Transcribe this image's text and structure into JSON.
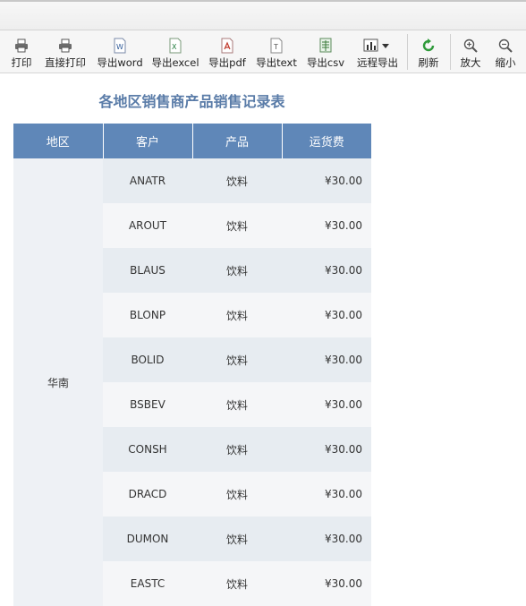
{
  "toolbar": {
    "items": [
      {
        "label": "打印",
        "icon": "printer-icon"
      },
      {
        "label": "直接打印",
        "icon": "printer-direct-icon"
      },
      {
        "label": "导出word",
        "icon": "word-doc-icon"
      },
      {
        "label": "导出excel",
        "icon": "excel-doc-icon"
      },
      {
        "label": "导出pdf",
        "icon": "pdf-doc-icon"
      },
      {
        "label": "导出text",
        "icon": "text-doc-icon"
      },
      {
        "label": "导出csv",
        "icon": "csv-doc-icon"
      },
      {
        "label": "远程导出",
        "icon": "bar-chart-icon"
      },
      {
        "label": "刷新",
        "icon": "refresh-icon"
      },
      {
        "label": "放大",
        "icon": "zoom-in-icon"
      },
      {
        "label": "缩小",
        "icon": "zoom-out-icon"
      }
    ]
  },
  "report": {
    "title": "各地区销售商产品销售记录表",
    "headers": [
      "地区",
      "客户",
      "产品",
      "运货费"
    ],
    "region": "华南",
    "rows": [
      {
        "customer": "ANATR",
        "product": "饮料",
        "fee": "¥30.00"
      },
      {
        "customer": "AROUT",
        "product": "饮料",
        "fee": "¥30.00"
      },
      {
        "customer": "BLAUS",
        "product": "饮料",
        "fee": "¥30.00"
      },
      {
        "customer": "BLONP",
        "product": "饮料",
        "fee": "¥30.00"
      },
      {
        "customer": "BOLID",
        "product": "饮料",
        "fee": "¥30.00"
      },
      {
        "customer": "BSBEV",
        "product": "饮料",
        "fee": "¥30.00"
      },
      {
        "customer": "CONSH",
        "product": "饮料",
        "fee": "¥30.00"
      },
      {
        "customer": "DRACD",
        "product": "饮料",
        "fee": "¥30.00"
      },
      {
        "customer": "DUMON",
        "product": "饮料",
        "fee": "¥30.00"
      },
      {
        "customer": "EASTC",
        "product": "饮料",
        "fee": "¥30.00"
      }
    ]
  },
  "colors": {
    "header_bg": "#5f87b8",
    "title": "#5a7ca8",
    "row_odd": "#e7ecf1",
    "row_even": "#f5f6f8"
  }
}
